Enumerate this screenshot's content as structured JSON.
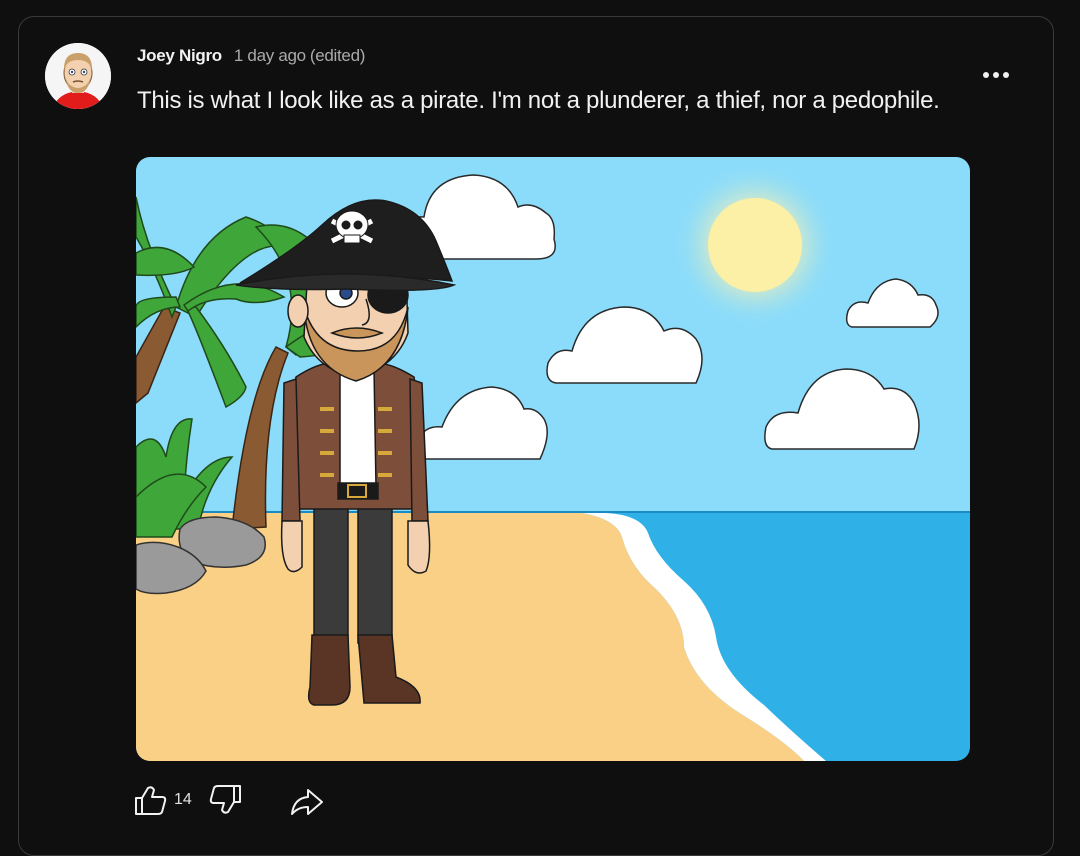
{
  "comment": {
    "author": "Joey Nigro",
    "timestamp": "1 day ago",
    "edited_label": "(edited)",
    "text": "This is what I look like as a pirate. I'm not a plunderer, a thief, nor a pedophile.",
    "like_count": "14"
  },
  "icons": {
    "menu": "more-vert-icon",
    "like": "thumb-up-icon",
    "dislike": "thumb-down-icon",
    "share": "share-icon"
  },
  "colors": {
    "background": "#0f0f0f",
    "card_border": "#3a3a3a",
    "text_primary": "#f1f1f1",
    "text_secondary": "#aaaaaa"
  }
}
